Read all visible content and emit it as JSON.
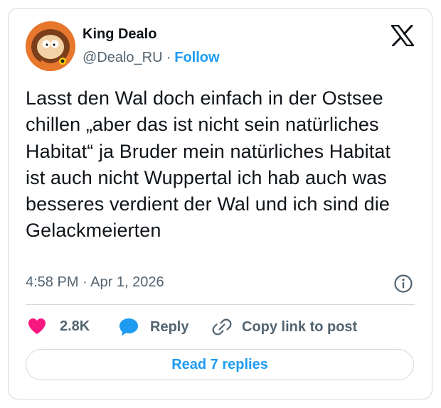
{
  "author": {
    "name": "King Dealo",
    "handle": "@Dealo_RU",
    "separator": "·",
    "follow_label": "Follow"
  },
  "tweet": {
    "text": "Lasst den Wal doch einfach in der Ostsee chillen „aber das ist nicht sein natürliches Habitat“ ja Bruder mein natürliches Habitat ist auch nicht Wuppertal ich hab auch was besseres verdient der Wal und ich sind die Gelackmeierten",
    "timestamp": "4:58 PM · Apr 1, 2026"
  },
  "actions": {
    "likes": "2.8K",
    "reply_label": "Reply",
    "copy_link_label": "Copy link to post"
  },
  "read_replies_label": "Read 7 replies",
  "icons": {
    "logo": "x-logo-icon",
    "info": "info-icon",
    "like": "heart-icon",
    "reply": "speech-bubble-icon",
    "copy": "link-icon"
  },
  "colors": {
    "accent": "#1d9bf0",
    "like": "#f91880",
    "text": "#0f1419",
    "secondary": "#536471",
    "border": "#cfd9de"
  }
}
